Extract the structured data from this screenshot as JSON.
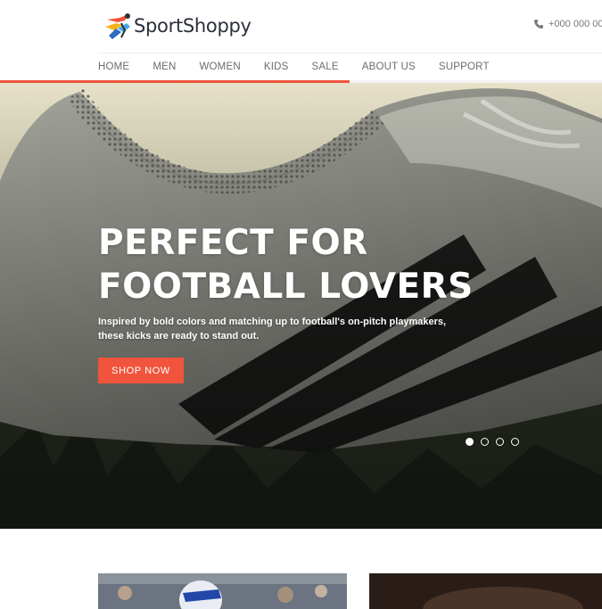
{
  "brand": {
    "name": "SportShoppy",
    "accent_color": "#f0543c",
    "logo_icon": "running-figure-icon"
  },
  "header": {
    "phone_icon": "phone-icon",
    "phone": "+000 000 00"
  },
  "nav": {
    "items": [
      {
        "label": "HOME"
      },
      {
        "label": "MEN"
      },
      {
        "label": "WOMEN"
      },
      {
        "label": "KIDS"
      },
      {
        "label": "SALE"
      },
      {
        "label": "ABOUT US"
      },
      {
        "label": "SUPPORT"
      }
    ],
    "slide_progress_percent": 58
  },
  "hero": {
    "background_image": "close-up of worn white football boot with black stripes on grass",
    "title_line1": "PERFECT FOR",
    "title_line2": "FOOTBALL LOVERS",
    "subtitle": "Inspired by bold colors and matching up to football's on-pitch playmakers, these kicks are ready to stand out.",
    "cta_label": "SHOP NOW",
    "slide_count": 4,
    "active_slide": 1
  },
  "cards": [
    {
      "image": "american football player in helmet"
    },
    {
      "image": "dark sports photo"
    }
  ]
}
